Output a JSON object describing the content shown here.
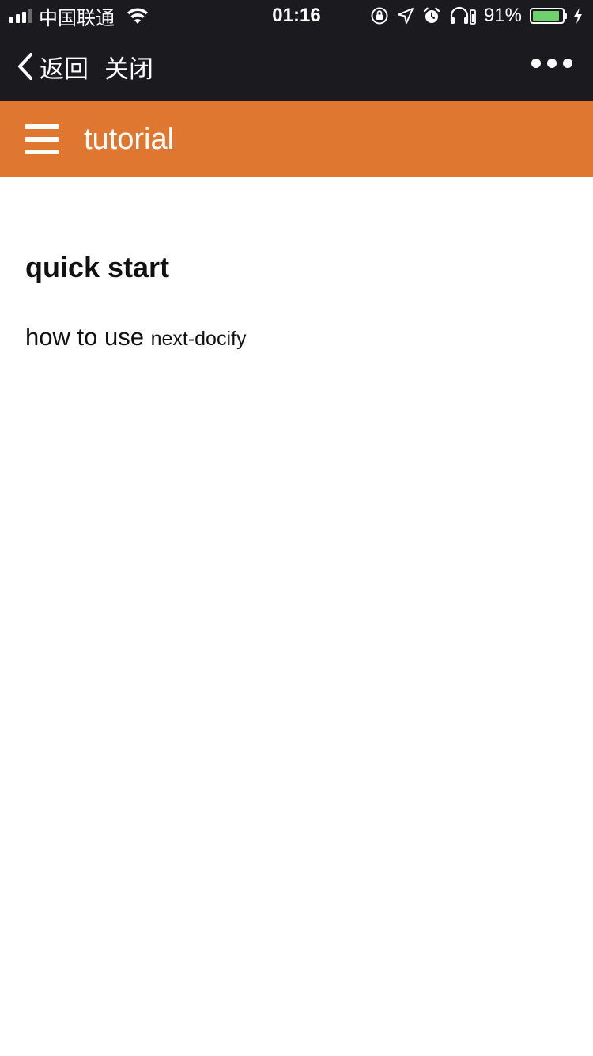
{
  "status_bar": {
    "carrier": "中国联通",
    "time": "01:16",
    "battery_percent": "91%",
    "battery_level": 0.91,
    "icons": [
      "signal-icon",
      "wifi-icon",
      "orientation-lock-icon",
      "location-icon",
      "alarm-icon",
      "headphones-icon",
      "battery-icon",
      "charging-icon"
    ]
  },
  "navbar": {
    "back_label": "返回",
    "close_label": "关闭",
    "more_icon": "more-icon"
  },
  "app_bar": {
    "title": "tutorial",
    "menu_icon": "hamburger-menu-icon",
    "background_color": "#e07730"
  },
  "content": {
    "heading": "quick start",
    "text": "how to use",
    "code": "next-docify"
  },
  "colors": {
    "system_bar": "#1b1a1f",
    "accent": "#e07730",
    "battery_green": "#6fd16c"
  }
}
